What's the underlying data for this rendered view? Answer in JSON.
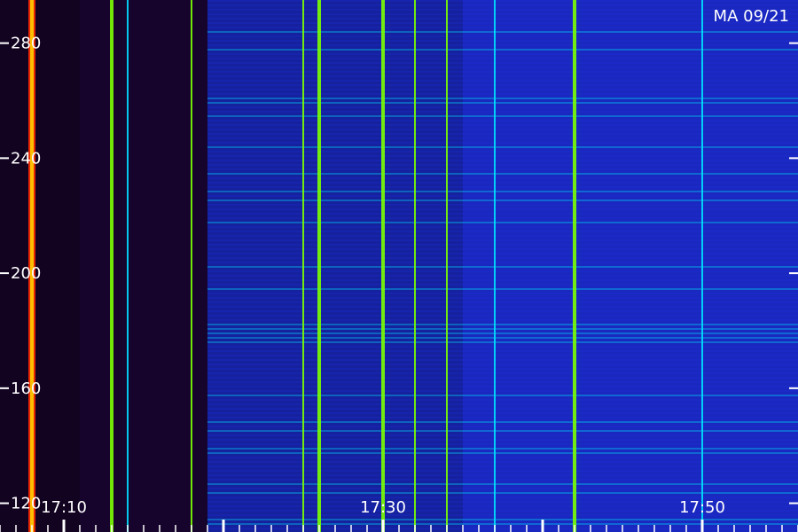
{
  "chart_data": {
    "type": "heatmap",
    "title": "",
    "station_label": "MA 09/21",
    "xlabel": "",
    "ylabel": "",
    "x_range": [
      "17:06",
      "17:56"
    ],
    "y_range": [
      110,
      295
    ],
    "y_ticks": [
      {
        "value": 280,
        "label": "280"
      },
      {
        "value": 240,
        "label": "240"
      },
      {
        "value": 200,
        "label": "200"
      },
      {
        "value": 160,
        "label": "160"
      },
      {
        "value": 120,
        "label": "120"
      }
    ],
    "x_ticks": [
      {
        "value": "17:10",
        "label": "17:10"
      },
      {
        "value": "17:30",
        "label": "17:30"
      },
      {
        "value": "17:50",
        "label": "17:50"
      }
    ],
    "intensity_regions": [
      {
        "from": "17:06",
        "to": "17:11",
        "level": 0.15
      },
      {
        "from": "17:11",
        "to": "17:19",
        "level": 0.25
      },
      {
        "from": "17:19",
        "to": "17:35",
        "level": 0.55
      },
      {
        "from": "17:35",
        "to": "17:56",
        "level": 0.7
      }
    ],
    "bursts": [
      {
        "time": "17:08",
        "intensity": 1.0
      },
      {
        "time": "17:13",
        "intensity": 0.8
      },
      {
        "time": "17:14",
        "intensity": 0.65
      },
      {
        "time": "17:18",
        "intensity": 0.7
      },
      {
        "time": "17:25",
        "intensity": 0.75
      },
      {
        "time": "17:26",
        "intensity": 0.85
      },
      {
        "time": "17:30",
        "intensity": 0.9
      },
      {
        "time": "17:32",
        "intensity": 0.75
      },
      {
        "time": "17:34",
        "intensity": 0.7
      },
      {
        "time": "17:37",
        "intensity": 0.6
      },
      {
        "time": "17:42",
        "intensity": 0.85
      },
      {
        "time": "17:50",
        "intensity": 0.6
      }
    ],
    "colors": {
      "background": "#000000",
      "low": "#3a0a6e",
      "mid": "#1e2fe0",
      "high": "#00e0ff",
      "burst": "#7cff00",
      "peak": "#ff2a00"
    }
  }
}
